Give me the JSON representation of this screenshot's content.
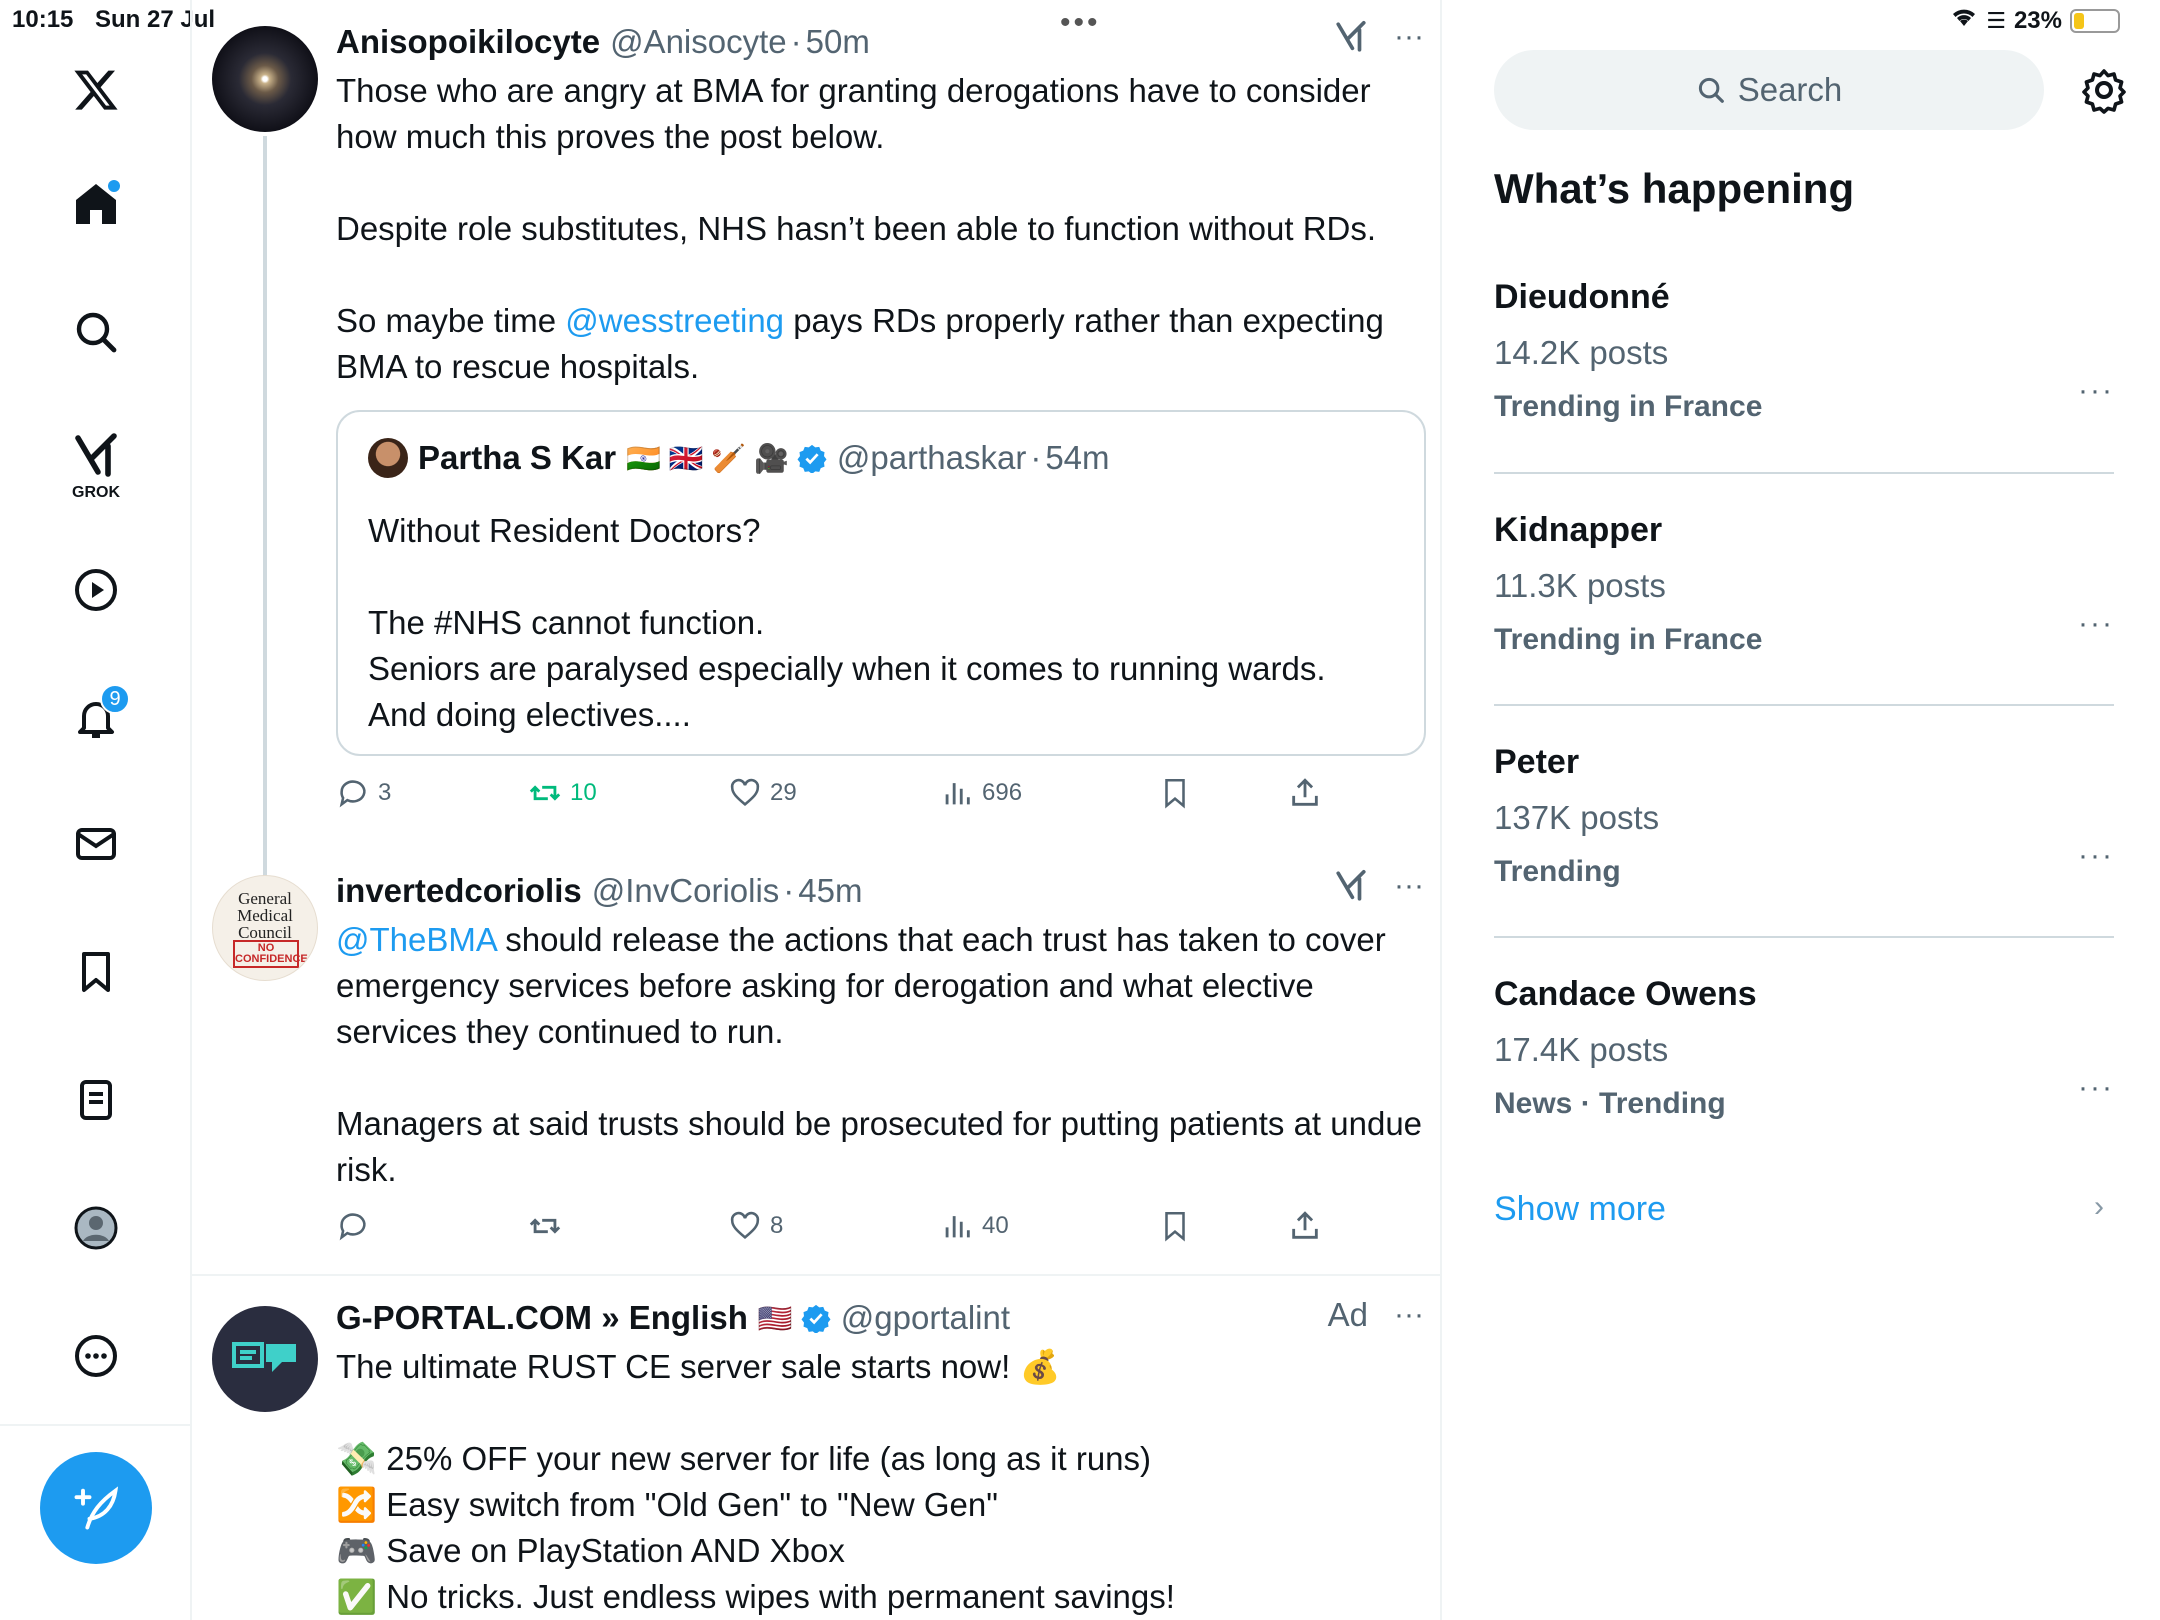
{
  "status_bar": {
    "time": "10:15",
    "date": "Sun 27 Jul",
    "battery": "23%"
  },
  "sidebar": {
    "grok_label": "GROK",
    "notifications_count": "9"
  },
  "tweets": [
    {
      "name": "Anisopoikilocyte",
      "handle": "@Anisocyte",
      "time": "50m",
      "text_1": "Those who are angry at BMA for granting derogations have to consider how much this proves the post below.\n\nDespite role substitutes, NHS hasn’t been able to function without RDs.\n\nSo maybe time ",
      "mention": "@wesstreeting",
      "text_2": " pays RDs properly rather than expecting BMA to rescue hospitals.",
      "quote": {
        "name": "Partha S Kar",
        "emoji": "🇮🇳 🇬🇧 🏏 🎥",
        "handle": "@parthaskar",
        "time": "54m",
        "text": "Without Resident Doctors?\n\nThe #NHS cannot function.\nSeniors are paralysed especially when it comes to running wards.\nAnd doing electives...."
      },
      "replies": "3",
      "reposts": "10",
      "likes": "29",
      "views": "696"
    },
    {
      "name": "invertedcoriolis",
      "handle": "@InvCoriolis",
      "time": "45m",
      "avatar_text_1": "General",
      "avatar_text_2": "Medical",
      "avatar_text_3": "Council",
      "avatar_stamp_1": "NO",
      "avatar_stamp_2": "CONFIDENCE",
      "mention": "@TheBMA",
      "text_1": " should release the actions that each trust has taken to cover emergency services before asking for derogation and what elective services they continued to run.\n\nManagers at said trusts should be prosecuted for putting patients at undue risk.",
      "replies": "",
      "reposts": "",
      "likes": "8",
      "views": "40"
    },
    {
      "name": "G-PORTAL.COM » English",
      "flag": "🇺🇸",
      "handle": "@gportalint",
      "ad_label": "Ad",
      "text": "The ultimate RUST CE server sale starts now! 💰\n\n💸 25% OFF your new server for life (as long as it runs)\n🔀 Easy switch from \"Old Gen\" to \"New Gen\"\n🎮 Save on PlayStation AND Xbox\n✅ No tricks. Just endless wipes with permanent savings!"
    }
  ],
  "right": {
    "search_placeholder": "Search",
    "heading": "What’s happening",
    "trends": [
      {
        "name": "Dieudonné",
        "posts": "14.2K posts",
        "context": "Trending in France"
      },
      {
        "name": "Kidnapper",
        "posts": "11.3K posts",
        "context": "Trending in France"
      },
      {
        "name": "Peter",
        "posts": "137K posts",
        "context": "Trending"
      },
      {
        "name": "Candace Owens",
        "posts": "17.4K posts",
        "context": "News · Trending"
      }
    ],
    "show_more": "Show more"
  },
  "colors": {
    "accent": "#1d9bf0",
    "repost_green": "#00ba7c",
    "secondary_text": "#536471"
  },
  "icons": [
    "x-logo-icon",
    "home-icon",
    "search-icon",
    "grok-icon",
    "video-icon",
    "bell-icon",
    "mail-icon",
    "bookmark-icon",
    "list-icon",
    "profile-icon",
    "more-icon",
    "compose-icon",
    "gear-icon",
    "reply-icon",
    "repost-icon",
    "like-icon",
    "views-icon",
    "share-icon",
    "verified-icon",
    "ellipsis-icon"
  ]
}
